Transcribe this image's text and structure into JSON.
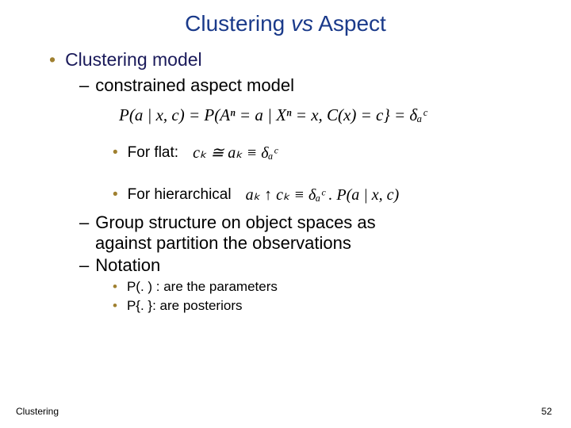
{
  "title": {
    "part1": "Clustering ",
    "italic": "vs",
    "part2": " Aspect"
  },
  "l1": {
    "text": "Clustering model"
  },
  "l2a": {
    "text": "constrained aspect model"
  },
  "formula_main": "P(a | x, c) = P(Aⁿ = a | Xⁿ = x, C(x) = c} = δₐᶜ",
  "l3a": {
    "label": "For flat:",
    "formula": "cₖ ≅ aₖ ≡ δₐᶜ"
  },
  "l3b": {
    "label": "For hierarchical",
    "formula": "aₖ ↑ cₖ ≡ δₐᶜ . P(a | x, c)"
  },
  "l2b": {
    "line1_pre": "Group structure on object spaces as",
    "line2_pre": "against partition the ",
    "line2_italic": "observations"
  },
  "l2c": {
    "text": "Notation"
  },
  "l4a": {
    "text": "P(. ) : are the parameters"
  },
  "l4b": {
    "text": "P{. }: are posteriors"
  },
  "footer": {
    "left": "Clustering",
    "right": "52"
  }
}
